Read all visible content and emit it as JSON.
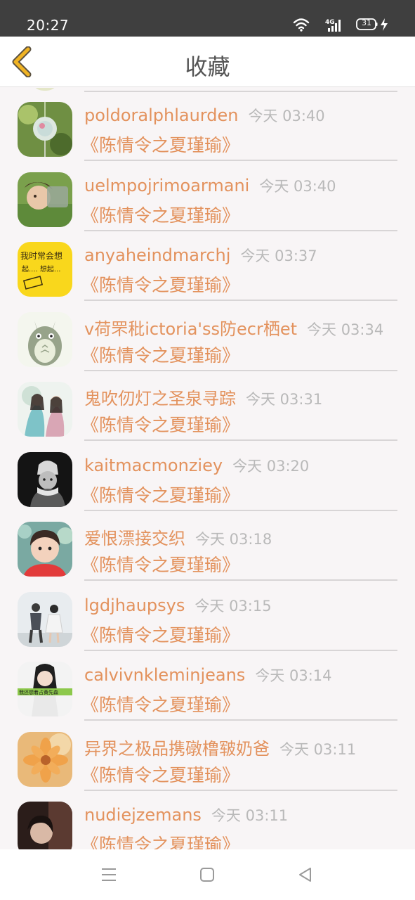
{
  "status_bar": {
    "time": "20:27",
    "network": "4G",
    "battery": "31"
  },
  "header": {
    "title": "收藏",
    "back_icon": "chevron-left-icon"
  },
  "favorites": [
    {
      "user": "poldoralphlaurden",
      "time": "今天 03:40",
      "title": "《陈情令之夏瑾瑜》",
      "avatar": "glass-wind-chime"
    },
    {
      "user": "uelmpojrimoarmani",
      "time": "今天 03:40",
      "title": "《陈情令之夏瑾瑜》",
      "avatar": "person-lying-grass"
    },
    {
      "user": "anyaheindmarchj",
      "time": "今天 03:37",
      "title": "《陈情令之夏瑾瑜》",
      "avatar": "yellow-handwriting"
    },
    {
      "user": "v荷罘秕ictoria'ss防ecr栖et",
      "time": "今天 03:34",
      "title": "《陈情令之夏瑾瑜》",
      "avatar": "totoro"
    },
    {
      "user": "鬼吹仞灯之圣泉寻踪",
      "time": "今天 03:31",
      "title": "《陈情令之夏瑾瑜》",
      "avatar": "illustrated-couple"
    },
    {
      "user": "kaitmacmonziey",
      "time": "今天 03:20",
      "title": "《陈情令之夏瑾瑜》",
      "avatar": "bw-beanie-person"
    },
    {
      "user": "爱恨漂接交织",
      "time": "今天 03:18",
      "title": "《陈情令之夏瑾瑜》",
      "avatar": "child-red-shirt"
    },
    {
      "user": "lgdjhaupsys",
      "time": "今天 03:15",
      "title": "《陈情令之夏瑾瑜》",
      "avatar": "couple-walking"
    },
    {
      "user": "calvivnkleminjeans",
      "time": "今天 03:14",
      "title": "《陈情令之夏瑾瑜》",
      "avatar": "girl-green-caption"
    },
    {
      "user": "异界之极品携礅橹皲奶爸",
      "time": "今天 03:11",
      "title": "《陈情令之夏瑾瑜》",
      "avatar": "orange-flower"
    },
    {
      "user": "nudiejzemans",
      "time": "今天 03:11",
      "title": "《陈情令之夏瑾瑜》",
      "avatar": "dark-portrait"
    }
  ],
  "avatar_captions": {
    "yellow": [
      "我时常会想",
      "起.... 想起..."
    ],
    "green_band": "我还想着占黄先森"
  },
  "colors": {
    "accent": "#e3925d",
    "time": "#b9b9b9",
    "back_icon": "#f0b323",
    "status_bar": "#3f3f3f",
    "background": "#f8f5f6"
  },
  "nav_bar": {
    "menu": "menu-icon",
    "home": "home-square-icon",
    "back": "back-triangle-icon"
  }
}
